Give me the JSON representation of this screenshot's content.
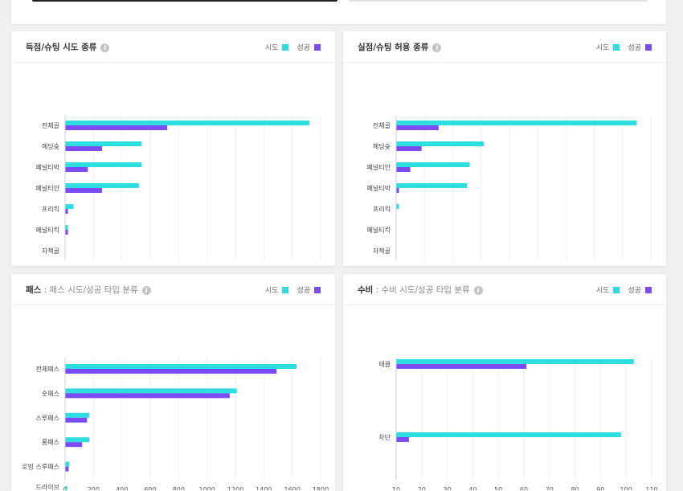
{
  "colors": {
    "attempt": "#2edde0",
    "success": "#7b4cf4"
  },
  "legend": {
    "attempt": "시도",
    "success": "성공"
  },
  "charts": [
    {
      "title": "득점/슈팅 시도 종류",
      "subtitle": "",
      "chart_data": {
        "type": "bar",
        "orientation": "horizontal",
        "categories": [
          "전체골",
          "헤딩슛",
          "페널티박",
          "페널티안",
          "프리킥",
          "페널티킥",
          "자책골"
        ],
        "series": [
          {
            "name": "시도",
            "values": [
              86,
              27,
              27,
              26,
              3,
              1,
              0
            ]
          },
          {
            "name": "성공",
            "values": [
              36,
              13,
              8,
              13,
              1,
              1,
              0
            ]
          }
        ],
        "xlim": [
          0,
          90
        ],
        "ticks": [
          0,
          10,
          20,
          30,
          40,
          50,
          60,
          70,
          80,
          90
        ],
        "grid": true
      }
    },
    {
      "title": "실점/슈팅 허용 종류",
      "subtitle": "",
      "chart_data": {
        "type": "bar",
        "orientation": "horizontal",
        "categories": [
          "전체골",
          "헤딩슛",
          "페널티안",
          "페널티박",
          "프리킥",
          "페널티킥",
          "자책골"
        ],
        "series": [
          {
            "name": "시도",
            "values": [
              85,
              31,
              26,
              25,
              1,
              0,
              0
            ]
          },
          {
            "name": "성공",
            "values": [
              15,
              9,
              5,
              1,
              0,
              0,
              0
            ]
          }
        ],
        "xlim": [
          0,
          90
        ],
        "ticks": [
          0,
          10,
          20,
          30,
          40,
          50,
          60,
          70,
          80,
          90
        ],
        "grid": true
      }
    },
    {
      "title": "패스",
      "subtitle": "패스 시도/성공 타입 분류",
      "chart_data": {
        "type": "bar",
        "orientation": "horizontal",
        "categories": [
          [
            "전체패스"
          ],
          [
            "숏패스"
          ],
          [
            "스루패스"
          ],
          [
            "롱패스"
          ],
          [
            "로빙 스루패스"
          ],
          [
            "드라이브",
            "땅볼 패스"
          ]
        ],
        "series": [
          {
            "name": "시도",
            "values": [
              1630,
              1210,
              170,
              170,
              30,
              15
            ]
          },
          {
            "name": "성공",
            "values": [
              1490,
              1160,
              155,
              120,
              25,
              10
            ]
          }
        ],
        "xlim": [
          0,
          1800
        ],
        "ticks": [
          0,
          200,
          400,
          600,
          800,
          1000,
          1200,
          1400,
          1600,
          1800
        ],
        "grid": true
      }
    },
    {
      "title": "수비",
      "subtitle": "수비 시도/성공 타입 분류",
      "chart_data": {
        "type": "bar",
        "orientation": "horizontal",
        "categories": [
          [
            "태클"
          ],
          [
            "차단"
          ]
        ],
        "series": [
          {
            "name": "시도",
            "values": [
              103,
              98
            ]
          },
          {
            "name": "성공",
            "values": [
              61,
              15
            ]
          }
        ],
        "xlim": [
          10,
          110
        ],
        "ticks": [
          10,
          20,
          30,
          40,
          50,
          60,
          70,
          80,
          90,
          100,
          110
        ],
        "grid": true
      }
    }
  ]
}
